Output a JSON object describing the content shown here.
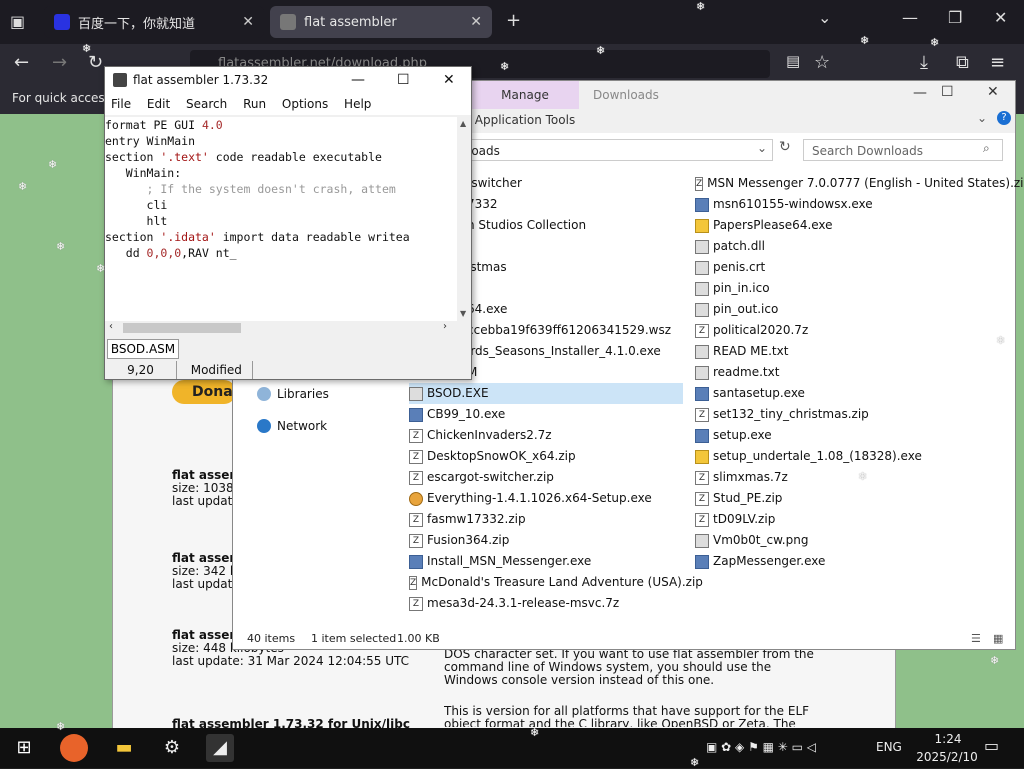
{
  "browser": {
    "tabs": [
      {
        "label": "百度一下，你就知道"
      },
      {
        "label": "flat assembler"
      }
    ],
    "url": "flatassembler.net/download.php",
    "bookmarks_text": "For quick access,"
  },
  "webpage": {
    "donate_label": "Donat",
    "entries": [
      {
        "title": "flat assem",
        "size": "size: 1038",
        "update": "last update"
      },
      {
        "title": "flat assem",
        "size": "size: 342 k",
        "update": "last update"
      },
      {
        "title": "flat assem",
        "size": "size: 448 kilobytes",
        "update": "last update: 31 Mar 2024 12:04:55 UTC"
      },
      {
        "title": "flat assembler 1.73.32 for Unix/libc"
      }
    ],
    "desc1": "DOS character set. If you want to use flat assembler from the command line of Windows system, you should use the Windows console version instead of this one.",
    "desc2": "This is version for all platforms that have support for the ELF object format and the C library, like OpenBSD or Zeta. The object file"
  },
  "explorer": {
    "manage_label": "Manage",
    "app_tools_label": "Application Tools",
    "downloads_tab": "Downloads",
    "address": "loads",
    "search_placeholder": "Search Downloads",
    "nav": [
      {
        "label": "Libraries"
      },
      {
        "label": "Network"
      }
    ],
    "col1": [
      "-switcher",
      "7332",
      "n Studios Collection",
      "",
      "istmas",
      "",
      "64.exe",
      "ccebba19f639ff61206341529.wsz",
      "irds_Seasons_Installer_4.1.0.exe",
      "M"
    ],
    "col2": [
      "BSOD.EXE",
      "CB99_10.exe",
      "ChickenInvaders2.7z",
      "DesktopSnowOK_x64.zip",
      "escargot-switcher.zip",
      "Everything-1.4.1.1026.x64-Setup.exe",
      "fasmw17332.zip",
      "Fusion364.zip",
      "Install_MSN_Messenger.exe",
      "McDonald's Treasure Land Adventure (USA).zip",
      "mesa3d-24.3.1-release-msvc.7z"
    ],
    "col3": [
      "MSN Messenger 7.0.0777 (English - United States).zip",
      "msn610155-windowsx.exe",
      "PapersPlease64.exe",
      "patch.dll",
      "penis.crt",
      "pin_in.ico",
      "pin_out.ico",
      "political2020.7z",
      "READ ME.txt",
      "readme.txt",
      "santasetup.exe",
      "set132_tiny_christmas.zip",
      "setup.exe",
      "setup_undertale_1.08_(18328).exe",
      "slimxmas.7z",
      "Stud_PE.zip",
      "tD09LV.zip",
      "Vm0b0t_cw.png",
      "ZapMessenger.exe"
    ],
    "status": {
      "items": "40 items",
      "selected": "1 item selected",
      "size": "1.00 KB"
    }
  },
  "fasm": {
    "title": "flat assembler 1.73.32",
    "menu": [
      "File",
      "Edit",
      "Search",
      "Run",
      "Options",
      "Help"
    ],
    "code": {
      "l1a": "format PE GUI ",
      "l1b": "4.0",
      "l2": "entry WinMain",
      "l3a": "section ",
      "l3b": "'.text'",
      "l3c": " code readable executable",
      "l4": "   WinMain:",
      "l5": "      ; If the system doesn't crash, attem",
      "l6": "      cli",
      "l7": "      hlt",
      "l8a": "section ",
      "l8b": "'.idata'",
      "l8c": " import data readable writea",
      "l9a": "   dd ",
      "l9b": "0,0,0",
      "l9c": ",RAV nt_"
    },
    "file_tab": "BSOD.ASM",
    "cursor_pos": "9,20",
    "modified": "Modified"
  },
  "taskbar": {
    "time": "1:24",
    "date": "2025/2/10",
    "lang": "ENG"
  }
}
